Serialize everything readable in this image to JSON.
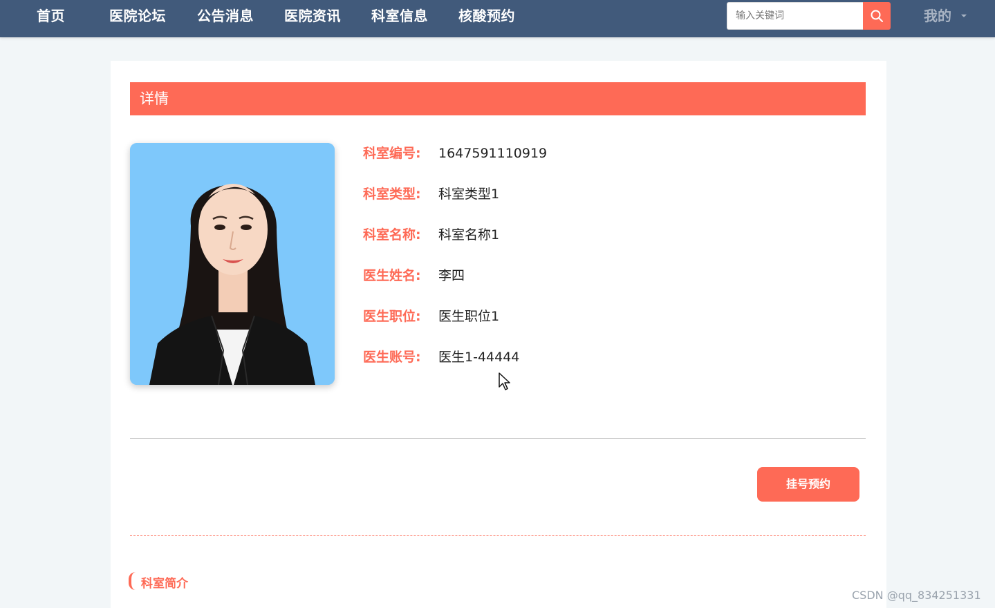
{
  "nav": {
    "items": [
      "首页",
      "医院论坛",
      "公告消息",
      "医院资讯",
      "科室信息",
      "核酸预约"
    ],
    "search_placeholder": "输入关键词",
    "search_icon": "search-icon",
    "mine_label": "我的"
  },
  "detail": {
    "header": "详情",
    "photo_description": "doctor-portrait",
    "fields": [
      {
        "label": "科室编号:",
        "value": "1647591110919"
      },
      {
        "label": "科室类型:",
        "value": "科室类型1"
      },
      {
        "label": "科室名称:",
        "value": "科室名称1"
      },
      {
        "label": "医生姓名:",
        "value": "李四"
      },
      {
        "label": "医生职位:",
        "value": "医生职位1"
      },
      {
        "label": "医生账号:",
        "value": "医生1-44444"
      }
    ],
    "book_button": "挂号预约",
    "section_title": "科室简介"
  },
  "watermark": "CSDN @qq_834251331",
  "colors": {
    "nav_bg": "#415a7b",
    "accent": "#fe6a56",
    "page_bg": "#f2f6f8"
  }
}
